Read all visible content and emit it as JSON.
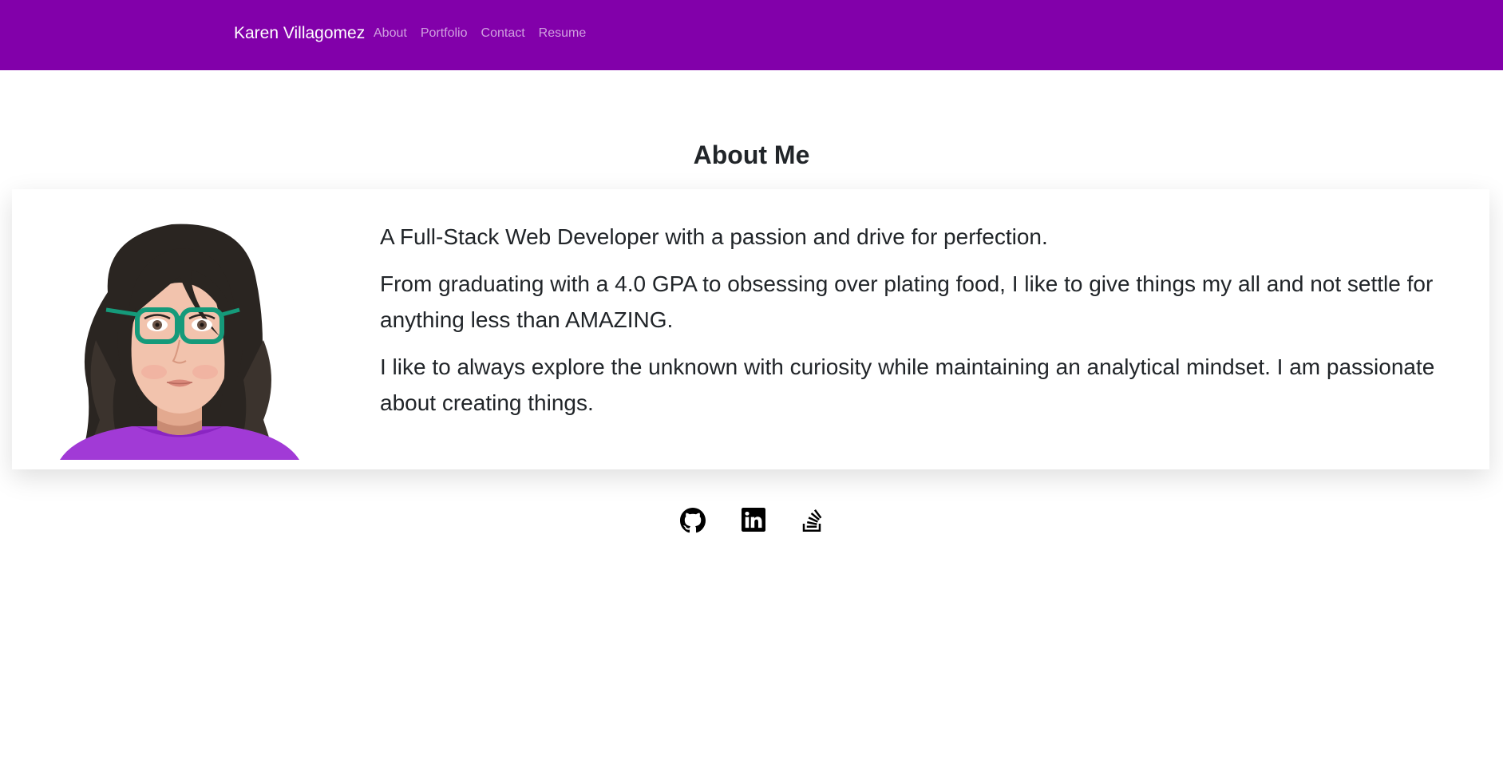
{
  "navbar": {
    "brand": "Karen Villagomez",
    "links": [
      {
        "label": "About"
      },
      {
        "label": "Portfolio"
      },
      {
        "label": "Contact"
      },
      {
        "label": "Resume"
      }
    ]
  },
  "main": {
    "title": "About Me",
    "avatar_icon": "cartoon-avatar-image",
    "paragraphs": [
      "A Full-Stack Web Developer with a passion and drive for perfection.",
      "From graduating with a 4.0 GPA to obsessing over plating food, I like to give things my all and not settle for anything less than AMAZING.",
      "I like to always explore the unknown with curiosity while maintaining an analytical mindset. I am passionate about creating things."
    ]
  },
  "socials": [
    {
      "icon": "github-icon"
    },
    {
      "icon": "linkedin-icon"
    },
    {
      "icon": "stackoverflow-icon"
    }
  ],
  "colors": {
    "navbar_bg": "#8200aa",
    "text": "#212529",
    "avatar_shirt": "#a13ad6",
    "avatar_glasses": "#159a7a"
  }
}
